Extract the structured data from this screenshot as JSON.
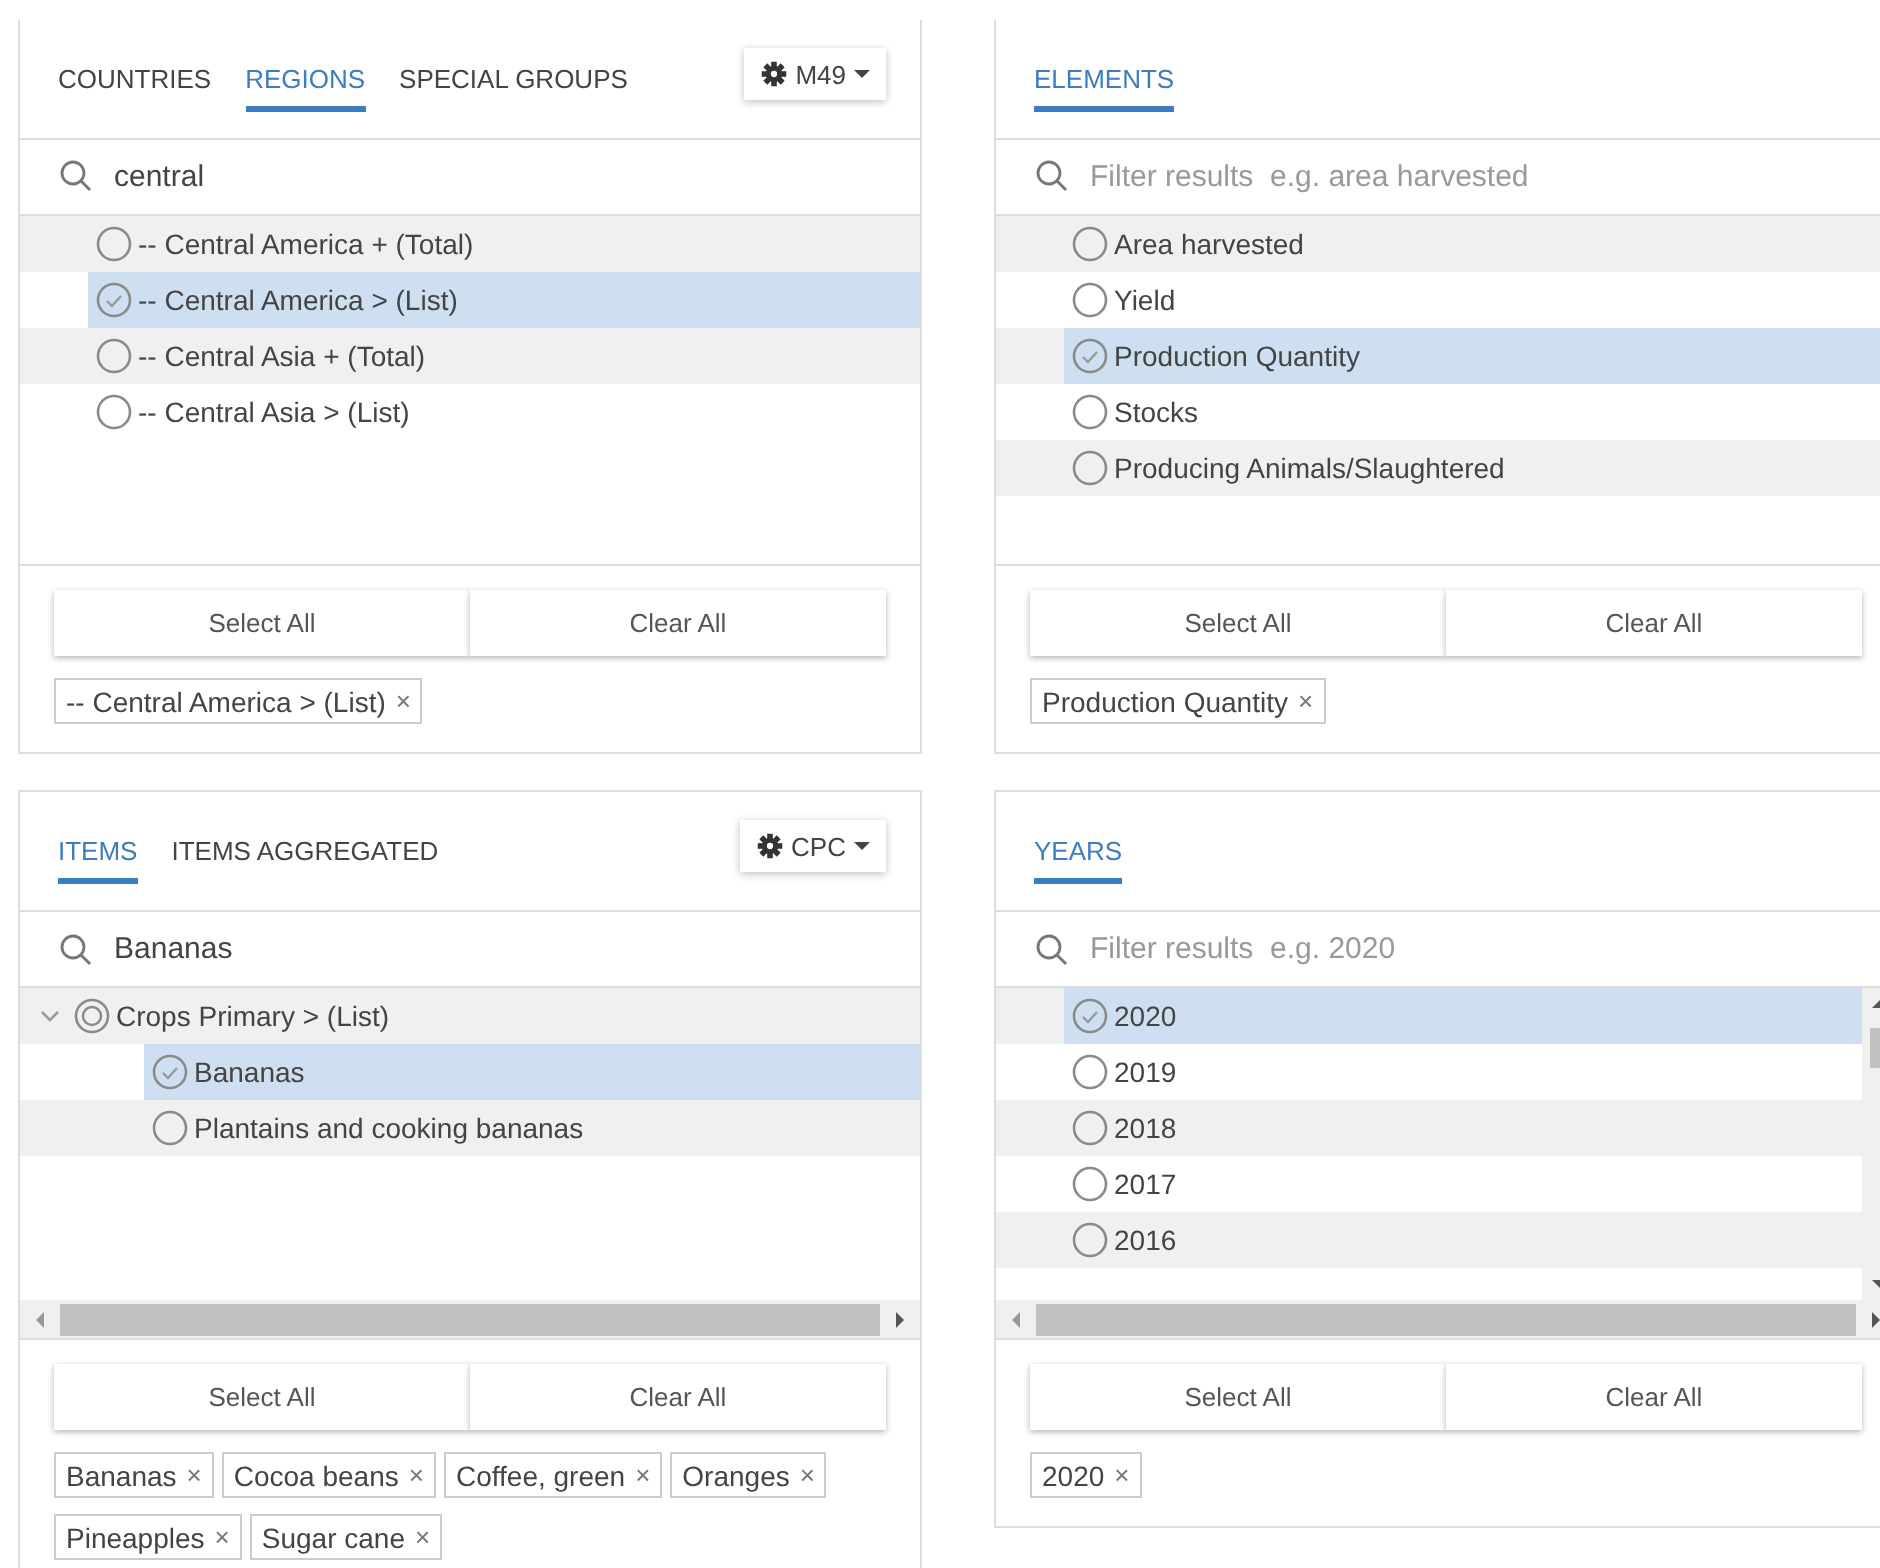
{
  "panels": [
    {
      "tabs": [
        {
          "label": "COUNTRIES",
          "selected": false
        },
        {
          "label": "REGIONS",
          "selected": true
        },
        {
          "label": "SPECIAL GROUPS",
          "selected": false
        }
      ],
      "dropdown": {
        "label": "M49"
      },
      "search": {
        "value": "central"
      },
      "list": {
        "rows": [
          {
            "label": "-- Central America + (Total)",
            "selected": false
          },
          {
            "label": "-- Central America > (List)",
            "selected": true
          },
          {
            "label": "-- Central Asia + (Total)",
            "selected": false
          },
          {
            "label": "-- Central Asia > (List)",
            "selected": false
          }
        ]
      },
      "buttons": [
        "Select All",
        "Clear All"
      ],
      "tags": [
        {
          "label": "-- Central America > (List)",
          "remove": "×"
        }
      ]
    },
    {
      "tabs": [
        {
          "label": "ELEMENTS",
          "selected": true
        }
      ],
      "search": {
        "placeholder": "Filter results  e.g. area harvested"
      },
      "list": {
        "rows": [
          {
            "label": "Area harvested",
            "selected": false
          },
          {
            "label": "Yield",
            "selected": false
          },
          {
            "label": "Production Quantity",
            "selected": true
          },
          {
            "label": "Stocks",
            "selected": false
          },
          {
            "label": "Producing Animals/Slaughtered",
            "selected": false
          }
        ]
      },
      "buttons": [
        "Select All",
        "Clear All"
      ],
      "tags": [
        {
          "label": "Production Quantity",
          "remove": "×"
        }
      ]
    },
    {
      "tabs": [
        {
          "label": "ITEMS",
          "selected": true
        },
        {
          "label": "ITEMS AGGREGATED",
          "selected": false
        }
      ],
      "dropdown": {
        "label": "CPC"
      },
      "search": {
        "value": "Bananas"
      },
      "list": {
        "horizontal_scrollbar": true,
        "rows": [
          {
            "label": "Crops Primary > (List)",
            "selected": false,
            "expanded": true,
            "children": [
              {
                "label": "Bananas",
                "selected": true
              },
              {
                "label": "Plantains and cooking bananas",
                "selected": false
              }
            ]
          }
        ]
      },
      "buttons": [
        "Select All",
        "Clear All"
      ],
      "tags": [
        {
          "label": "Bananas",
          "remove": "×"
        },
        {
          "label": "Cocoa beans",
          "remove": "×"
        },
        {
          "label": "Coffee, green",
          "remove": "×"
        },
        {
          "label": "Oranges",
          "remove": "×"
        },
        {
          "label": "Pineapples",
          "remove": "×"
        },
        {
          "label": "Sugar cane",
          "remove": "×"
        }
      ]
    },
    {
      "tabs": [
        {
          "label": "YEARS",
          "selected": true
        }
      ],
      "search": {
        "placeholder": "Filter results  e.g. 2020"
      },
      "list": {
        "horizontal_scrollbar": true,
        "vertical_scrollbar": true,
        "rows": [
          {
            "label": "2020",
            "selected": true
          },
          {
            "label": "2019",
            "selected": false
          },
          {
            "label": "2018",
            "selected": false
          },
          {
            "label": "2017",
            "selected": false
          },
          {
            "label": "2016",
            "selected": false
          }
        ]
      },
      "buttons": [
        "Select All",
        "Clear All"
      ],
      "tags": [
        {
          "label": "2020",
          "remove": "×"
        }
      ]
    }
  ]
}
